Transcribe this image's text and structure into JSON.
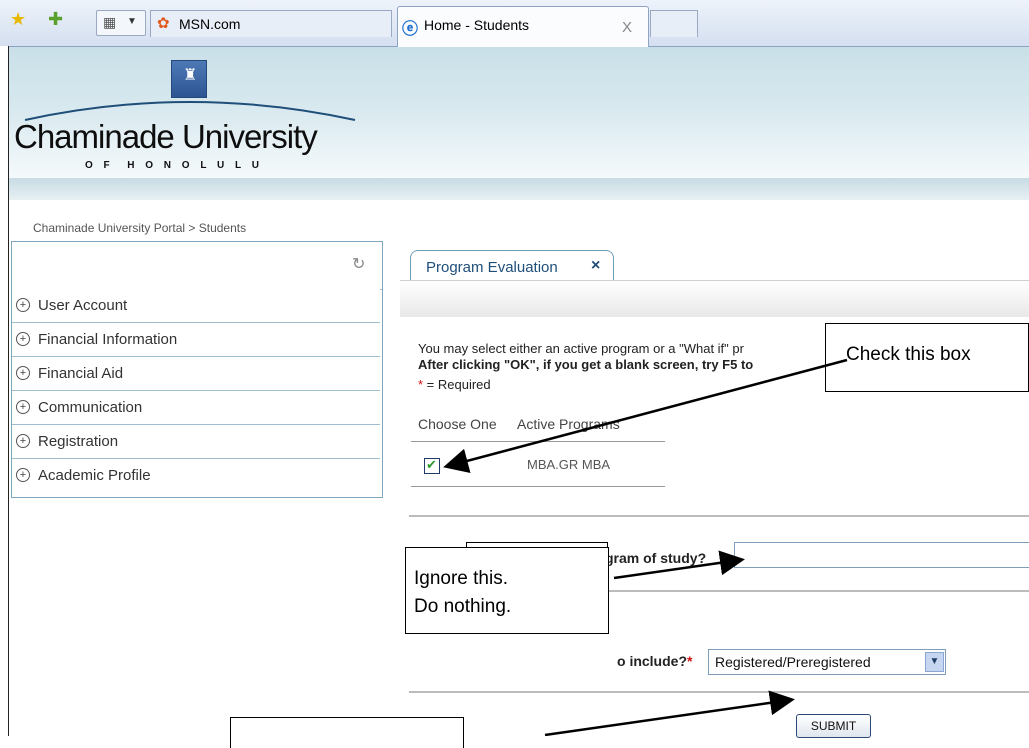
{
  "browser": {
    "tab_msn_label": "MSN.com",
    "tab_active_label": "Home - Students",
    "tab_close": "X"
  },
  "banner": {
    "university_name": "Chaminade University",
    "subtitle": "O F  H O N O L U L U"
  },
  "breadcrumb": "Chaminade University Portal > Students",
  "sidebar": {
    "items": [
      {
        "label": "User Account"
      },
      {
        "label": "Financial Information"
      },
      {
        "label": "Financial Aid"
      },
      {
        "label": "Communication"
      },
      {
        "label": "Registration"
      },
      {
        "label": "Academic Profile"
      }
    ]
  },
  "main": {
    "tab_label": "Program Evaluation",
    "tab_close": "×",
    "intro_line1": "You may select either an active program or a \"What if\" pr",
    "intro_line2": "After clicking \"OK\", if you get a blank screen, try F5 to",
    "required_mark": "*",
    "required_text": " = Required",
    "table": {
      "col_choose": "Choose One",
      "col_programs": "Active Programs",
      "row_program": "MBA.GR MBA"
    },
    "checkmark": "✔",
    "program_of_study_label": "gram of study?",
    "include_label": "o include?",
    "include_required": "*",
    "include_select_value": "Registered/Preregistered",
    "submit_label": "SUBMIT"
  },
  "callouts": {
    "check_box": "Check this box",
    "ignore_line1": "Ignore this.",
    "ignore_line2": "Do nothing."
  },
  "colors": {
    "accent_blue": "#1f4e79",
    "sidebar_border": "#7fa7bf",
    "required_red": "#d01010"
  },
  "icons": {
    "favorites": "star-icon",
    "add_favorite": "star-plus-icon",
    "quick_tabs": "grid-icon",
    "msn": "butterfly-icon",
    "ie": "ie-icon",
    "refresh": "refresh-icon",
    "expand": "plus-circle-icon",
    "dropdown": "chevron-down-icon"
  }
}
